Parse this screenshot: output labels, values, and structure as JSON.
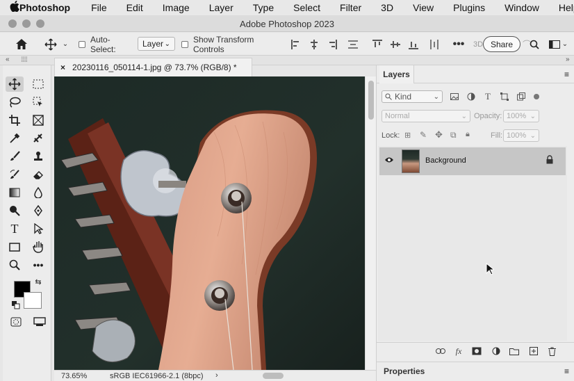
{
  "menubar": {
    "apple_icon": "apple-icon",
    "items": [
      "Photoshop",
      "File",
      "Edit",
      "Image",
      "Layer",
      "Type",
      "Select",
      "Filter",
      "3D",
      "View",
      "Plugins",
      "Window",
      "Help"
    ]
  },
  "window": {
    "title": "Adobe Photoshop 2023"
  },
  "options": {
    "auto_select_label": "Auto-Select:",
    "auto_select_value": "Layer",
    "show_transform_label": "Show Transform Controls",
    "mode_3d": "3D",
    "share_label": "Share"
  },
  "document": {
    "tab_title": "20230116_050114-1.jpg @ 73.7% (RGB/8) *",
    "zoom": "73.65%",
    "color_profile": "sRGB IEC61966-2.1 (8bpc)"
  },
  "layers_panel": {
    "tab_label": "Layers",
    "filter_label": "Kind",
    "blend_mode": "Normal",
    "opacity_label": "Opacity:",
    "opacity_value": "100%",
    "lock_label": "Lock:",
    "fill_label": "Fill:",
    "fill_value": "100%",
    "layers": [
      {
        "name": "Background",
        "visible": true,
        "locked": true
      }
    ]
  },
  "properties_panel": {
    "tab_label": "Properties"
  },
  "colors": {
    "foreground": "#000000",
    "background": "#ffffff",
    "selected_layer": "#c6c6c6"
  }
}
